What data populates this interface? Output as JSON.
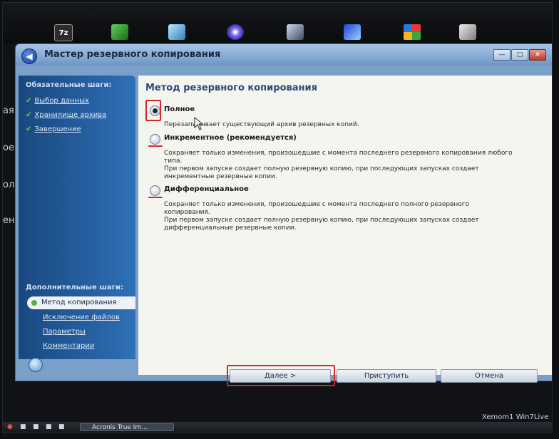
{
  "desktop": {
    "top_icons": [
      "7z-icon",
      "notebook-icon",
      "pen-icon",
      "disc-icon",
      "ball-icon",
      "flag-icon",
      "windows-icon",
      "clipboard-icon"
    ],
    "left_fragments": [
      "ая с",
      "ое",
      "ол",
      "ен"
    ]
  },
  "window": {
    "title": "Мастер резервного копирования",
    "controls": {
      "minimize": "—",
      "maximize": "□",
      "close": "✕"
    }
  },
  "sidebar": {
    "required_heading": "Обязательные шаги:",
    "required_steps": [
      {
        "label": "Выбор данных"
      },
      {
        "label": "Хранилище архива"
      },
      {
        "label": "Завершение"
      }
    ],
    "optional_heading": "Дополнительные шаги:",
    "active_step": "Метод копирования",
    "optional_steps": [
      {
        "label": "Исключение файлов"
      },
      {
        "label": "Параметры"
      },
      {
        "label": "Комментарии"
      }
    ]
  },
  "content": {
    "title": "Метод резервного копирования",
    "options": [
      {
        "label": "Полное",
        "selected": true,
        "desc": [
          "Перезаписывает существующий архив резервных копий."
        ]
      },
      {
        "label": "Инкрементное (рекомендуется)",
        "selected": false,
        "desc": [
          "Сохраняет только изменения, произошедшие с момента последнего резервного копирования любого",
          "типа.",
          "При первом запуске создает полную резервную копию, при последующих запусках создает",
          "инкрементные резервные копии."
        ]
      },
      {
        "label": "Дифференциальное",
        "selected": false,
        "desc": [
          "Сохраняет только изменения, произошедшие с момента последнего полного резервного",
          "копирования.",
          "При первом запуске создает полную резервную копию, при последующих запусках создает",
          "дифференциальные резервные копии."
        ]
      }
    ]
  },
  "buttons": {
    "next": "Далее >",
    "start": "Приступить",
    "cancel": "Отмена"
  },
  "taskbar": {
    "active_app": "Acronis True Im..."
  },
  "watermark": "Xemom1 Win7Live"
}
